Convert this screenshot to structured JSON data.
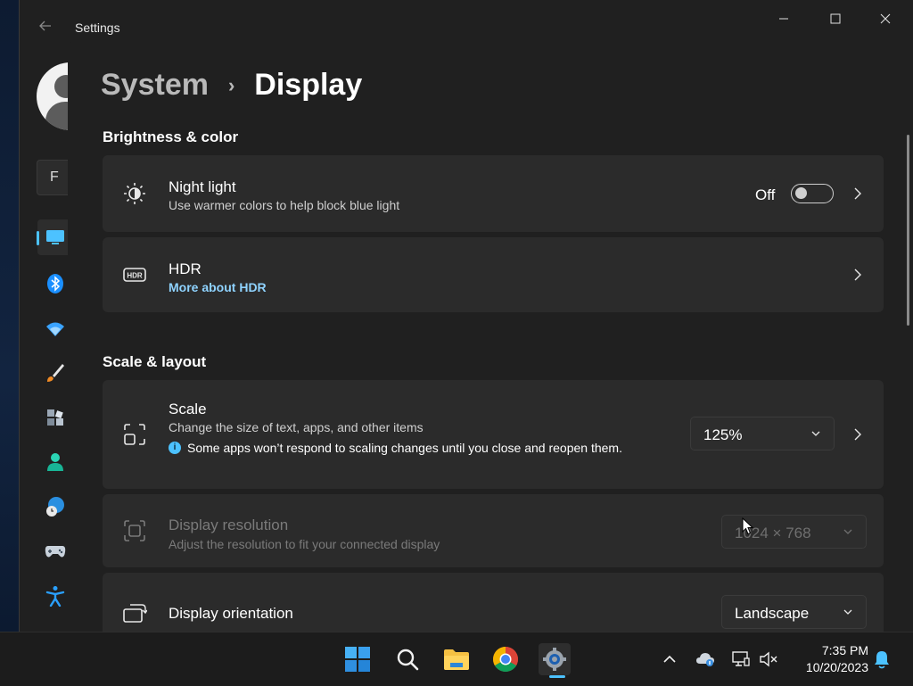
{
  "window": {
    "app_title": "Settings",
    "back_icon": "back-arrow-icon",
    "controls": [
      "minimize-icon",
      "maximize-icon",
      "close-icon"
    ]
  },
  "sidebar": {
    "search_text": "F",
    "nav_items": [
      {
        "id": "system",
        "icon": "monitor-icon",
        "active": true
      },
      {
        "id": "bluetooth",
        "icon": "bluetooth-icon"
      },
      {
        "id": "network",
        "icon": "wifi-icon"
      },
      {
        "id": "personalization",
        "icon": "brush-icon"
      },
      {
        "id": "apps",
        "icon": "apps-icon"
      },
      {
        "id": "accounts",
        "icon": "person-icon"
      },
      {
        "id": "time-language",
        "icon": "globe-clock-icon"
      },
      {
        "id": "gaming",
        "icon": "gamepad-icon"
      },
      {
        "id": "accessibility",
        "icon": "accessibility-icon"
      }
    ]
  },
  "breadcrumb": {
    "parent": "System",
    "separator": "›",
    "current": "Display"
  },
  "sections": {
    "brightness": {
      "title": "Brightness & color"
    },
    "scale_layout": {
      "title": "Scale & layout"
    }
  },
  "night_light": {
    "title": "Night light",
    "subtitle": "Use warmer colors to help block blue light",
    "toggle_label": "Off",
    "toggle_on": false,
    "icon": "brightness-icon"
  },
  "hdr": {
    "title": "HDR",
    "link": "More about HDR",
    "icon": "hdr-icon"
  },
  "scale": {
    "title": "Scale",
    "subtitle": "Change the size of text, apps, and other items",
    "note": "Some apps won’t respond to scaling changes until you close and reopen them.",
    "value": "125%",
    "icon": "scale-icon"
  },
  "resolution": {
    "title": "Display resolution",
    "subtitle": "Adjust the resolution to fit your connected display",
    "value": "1024 × 768",
    "disabled": true,
    "icon": "resolution-icon"
  },
  "orientation": {
    "title": "Display orientation",
    "value": "Landscape",
    "icon": "orientation-icon"
  },
  "taskbar": {
    "apps": [
      "windows-start-icon",
      "search-icon",
      "file-explorer-icon",
      "chrome-icon",
      "settings-gear-icon"
    ],
    "tray": [
      "chevron-up-icon",
      "onedrive-icon",
      "network-icon",
      "volume-muted-icon",
      "notification-bell-icon"
    ],
    "time": "7:35 PM",
    "date": "10/20/2023"
  },
  "colors": {
    "accent": "#4cc2ff",
    "window_bg": "#202020",
    "card_bg": "#2b2b2b",
    "link": "#8fd3ff"
  }
}
